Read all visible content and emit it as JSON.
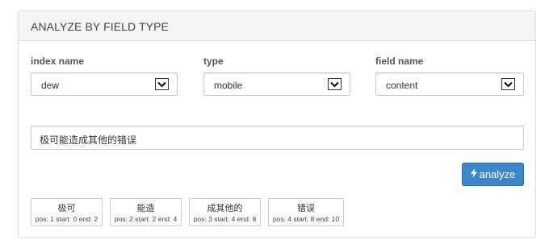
{
  "panel": {
    "title": "ANALYZE BY FIELD TYPE"
  },
  "fields": {
    "index": {
      "label": "index name",
      "value": "dew"
    },
    "type": {
      "label": "type",
      "value": "mobile"
    },
    "field": {
      "label": "field name",
      "value": "content"
    }
  },
  "text_input": {
    "value": "极可能造成其他的错误"
  },
  "analyze_button": {
    "label": "analyze",
    "icon": "bolt-icon",
    "color": "#3a87cc"
  },
  "tokens": [
    {
      "term": "极可",
      "pos": "1",
      "start": "0",
      "end": "2",
      "meta": "pos: 1 start: 0 end: 2"
    },
    {
      "term": "能造",
      "pos": "2",
      "start": "2",
      "end": "4",
      "meta": "pos: 2 start: 2 end: 4"
    },
    {
      "term": "成其他的",
      "pos": "3",
      "start": "4",
      "end": "8",
      "meta": "pos: 3 start: 4 end: 8"
    },
    {
      "term": "错误",
      "pos": "4",
      "start": "8",
      "end": "10",
      "meta": "pos: 4 start: 8 end: 10"
    }
  ]
}
